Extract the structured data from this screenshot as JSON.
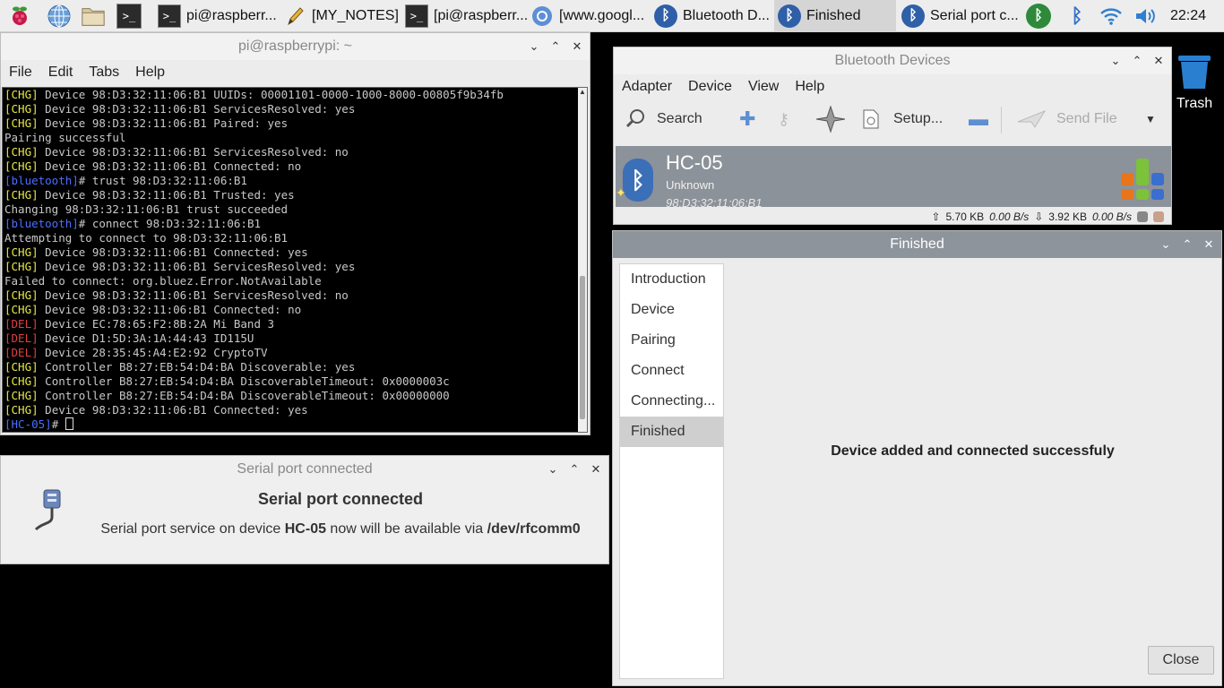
{
  "taskbar": {
    "tasks": [
      {
        "label": "pi@raspberr..."
      },
      {
        "label": "[MY_NOTES]"
      },
      {
        "label": "[pi@raspberr..."
      },
      {
        "label": "[www.googl..."
      },
      {
        "label": "Bluetooth D..."
      },
      {
        "label": "Finished"
      },
      {
        "label": "Serial port c..."
      }
    ],
    "clock": "22:24"
  },
  "terminal": {
    "title": "pi@raspberrypi: ~",
    "menu": [
      "File",
      "Edit",
      "Tabs",
      "Help"
    ],
    "lines": [
      {
        "tag": "[CHG]",
        "type": "chg",
        "text": " Device 98:D3:32:11:06:B1 UUIDs: 00001101-0000-1000-8000-00805f9b34fb"
      },
      {
        "tag": "[CHG]",
        "type": "chg",
        "text": " Device 98:D3:32:11:06:B1 ServicesResolved: yes"
      },
      {
        "tag": "[CHG]",
        "type": "chg",
        "text": " Device 98:D3:32:11:06:B1 Paired: yes"
      },
      {
        "tag": "",
        "type": "plain",
        "text": "Pairing successful"
      },
      {
        "tag": "[CHG]",
        "type": "chg",
        "text": " Device 98:D3:32:11:06:B1 ServicesResolved: no"
      },
      {
        "tag": "[CHG]",
        "type": "chg",
        "text": " Device 98:D3:32:11:06:B1 Connected: no"
      },
      {
        "tag": "[bluetooth]",
        "type": "bt",
        "text": "# trust 98:D3:32:11:06:B1"
      },
      {
        "tag": "[CHG]",
        "type": "chg",
        "text": " Device 98:D3:32:11:06:B1 Trusted: yes"
      },
      {
        "tag": "",
        "type": "plain",
        "text": "Changing 98:D3:32:11:06:B1 trust succeeded"
      },
      {
        "tag": "[bluetooth]",
        "type": "bt",
        "text": "# connect 98:D3:32:11:06:B1"
      },
      {
        "tag": "",
        "type": "plain",
        "text": "Attempting to connect to 98:D3:32:11:06:B1"
      },
      {
        "tag": "[CHG]",
        "type": "chg",
        "text": " Device 98:D3:32:11:06:B1 Connected: yes"
      },
      {
        "tag": "[CHG]",
        "type": "chg",
        "text": " Device 98:D3:32:11:06:B1 ServicesResolved: yes"
      },
      {
        "tag": "",
        "type": "plain",
        "text": "Failed to connect: org.bluez.Error.NotAvailable"
      },
      {
        "tag": "[CHG]",
        "type": "chg",
        "text": " Device 98:D3:32:11:06:B1 ServicesResolved: no"
      },
      {
        "tag": "[CHG]",
        "type": "chg",
        "text": " Device 98:D3:32:11:06:B1 Connected: no"
      },
      {
        "tag": "[DEL]",
        "type": "del",
        "text": " Device EC:78:65:F2:8B:2A Mi Band 3"
      },
      {
        "tag": "[DEL]",
        "type": "del",
        "text": " Device D1:5D:3A:1A:44:43 ID115U"
      },
      {
        "tag": "[DEL]",
        "type": "del",
        "text": " Device 28:35:45:A4:E2:92 CryptoTV"
      },
      {
        "tag": "[CHG]",
        "type": "chg",
        "text": " Controller B8:27:EB:54:D4:BA Discoverable: yes"
      },
      {
        "tag": "[CHG]",
        "type": "chg",
        "text": " Controller B8:27:EB:54:D4:BA DiscoverableTimeout: 0x0000003c"
      },
      {
        "tag": "[CHG]",
        "type": "chg",
        "text": " Controller B8:27:EB:54:D4:BA DiscoverableTimeout: 0x00000000"
      },
      {
        "tag": "[CHG]",
        "type": "chg",
        "text": " Device 98:D3:32:11:06:B1 Connected: yes"
      }
    ],
    "prompt": {
      "tag": "[HC-05]",
      "text": "# "
    }
  },
  "serial_notice": {
    "title": "Serial port connected",
    "heading": "Serial port connected",
    "msg_before": "Serial port service on device ",
    "device": "HC-05",
    "msg_middle": " now will be available via ",
    "port": "/dev/rfcomm0"
  },
  "bt_devices": {
    "title": "Bluetooth Devices",
    "menu": [
      "Adapter",
      "Device",
      "View",
      "Help"
    ],
    "toolbar": {
      "search": "Search",
      "setup": "Setup...",
      "send_file": "Send File"
    },
    "device": {
      "name": "HC-05",
      "type": "Unknown",
      "address": "98:D3:32:11:06:B1"
    },
    "status": {
      "up": "5.70 KB",
      "up_rate": "0.00 B/s",
      "down": "3.92 KB",
      "down_rate": "0.00 B/s"
    }
  },
  "wizard": {
    "title": "Finished",
    "steps": [
      "Introduction",
      "Device",
      "Pairing",
      "Connect",
      "Connecting...",
      "Finished"
    ],
    "message": "Device added and connected successfuly",
    "close_label": "Close"
  },
  "desktop": {
    "trash_label": "Trash"
  },
  "colors": {
    "chg": "#e6e645",
    "del": "#e04040",
    "prompt": "#4b6fff",
    "bt_blue": "#2f5fa8"
  }
}
